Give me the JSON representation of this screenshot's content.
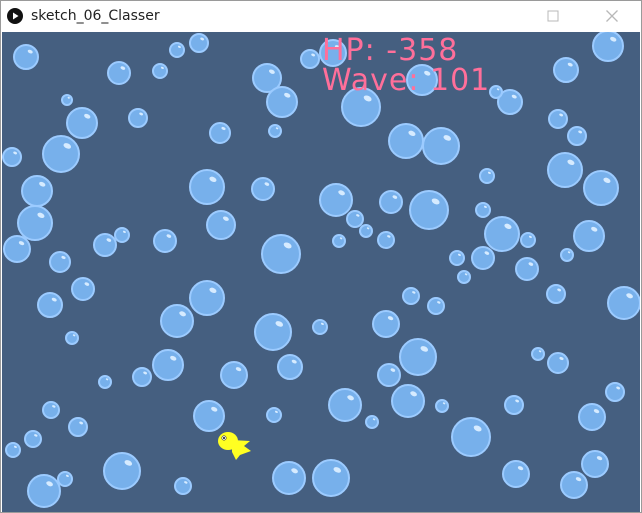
{
  "window": {
    "title": "sketch_06_Classer",
    "app_icon": "processing-play-icon",
    "controls": [
      "maximize-icon",
      "close-icon"
    ]
  },
  "hud": {
    "hp_text": "HP: -358",
    "wave_text": "Wave: 101"
  },
  "colors": {
    "background": "#455f80",
    "bubble_fill": "#7ab4f0",
    "bubble_stroke": "#9ccbff",
    "hud": "#ff6f9a",
    "player": "#ffff22"
  },
  "player": {
    "type": "yellow-fish"
  }
}
